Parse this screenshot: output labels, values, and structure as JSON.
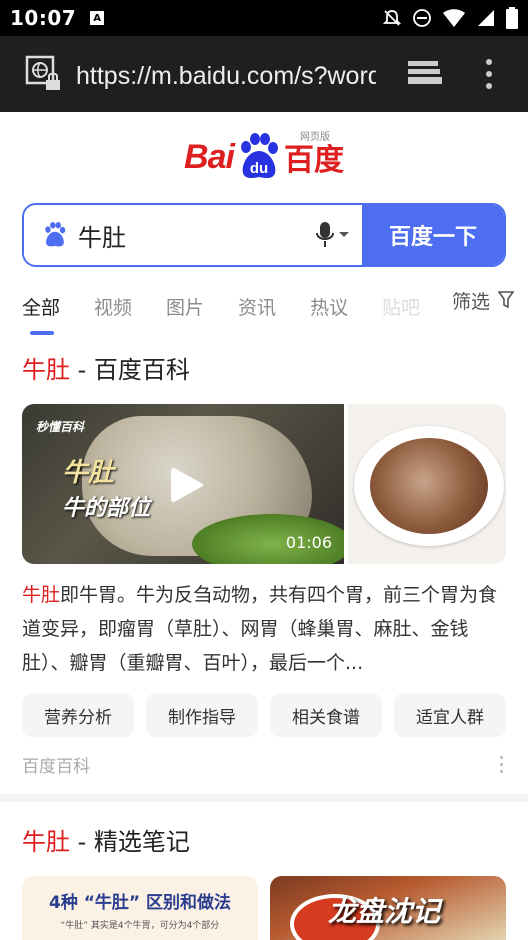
{
  "status_bar": {
    "time": "10:07",
    "notification_glyph": "A"
  },
  "browser": {
    "url": "https://m.baidu.com/s?word=牛肚"
  },
  "logo": {
    "text_bai": "Bai",
    "text_du": "du",
    "text_cn": "百度",
    "tag": "网页版"
  },
  "search": {
    "query": "牛肚",
    "button_label": "百度一下"
  },
  "tabs": {
    "items": [
      {
        "label": "全部",
        "active": true
      },
      {
        "label": "视频",
        "active": false
      },
      {
        "label": "图片",
        "active": false
      },
      {
        "label": "资讯",
        "active": false
      },
      {
        "label": "热议",
        "active": false
      },
      {
        "label": "贴吧",
        "active": false
      }
    ],
    "filter_label": "筛选"
  },
  "result1": {
    "title_keyword": "牛肚",
    "title_rest": " - 百度百科",
    "video": {
      "brand": "秒懂百科",
      "caption_line1": "牛肚",
      "caption_line2": "牛的部位",
      "duration": "01:06"
    },
    "summary_keyword": "牛肚",
    "summary_rest": "即牛胃。牛为反刍动物，共有四个胃，前三个胃为食道变异，即瘤胃（草肚）、网胃（蜂巢胃、麻肚、金钱肚）、瓣胃（重瓣胃、百叶），最后一个...",
    "chips": [
      "营养分析",
      "制作指导",
      "相关食谱",
      "适宜人群"
    ],
    "source": "百度百科"
  },
  "result2": {
    "title_keyword": "牛肚",
    "title_rest": " - 精选笔记",
    "note1_title": "4种 “牛肚” 区别和做法",
    "note1_sub": "“牛肚” 其实是4个牛胃，可分为4个部分",
    "note2_title": "龙盘沈记"
  },
  "colors": {
    "accent": "#4e6ef2",
    "brand_red": "#de1f1f"
  }
}
